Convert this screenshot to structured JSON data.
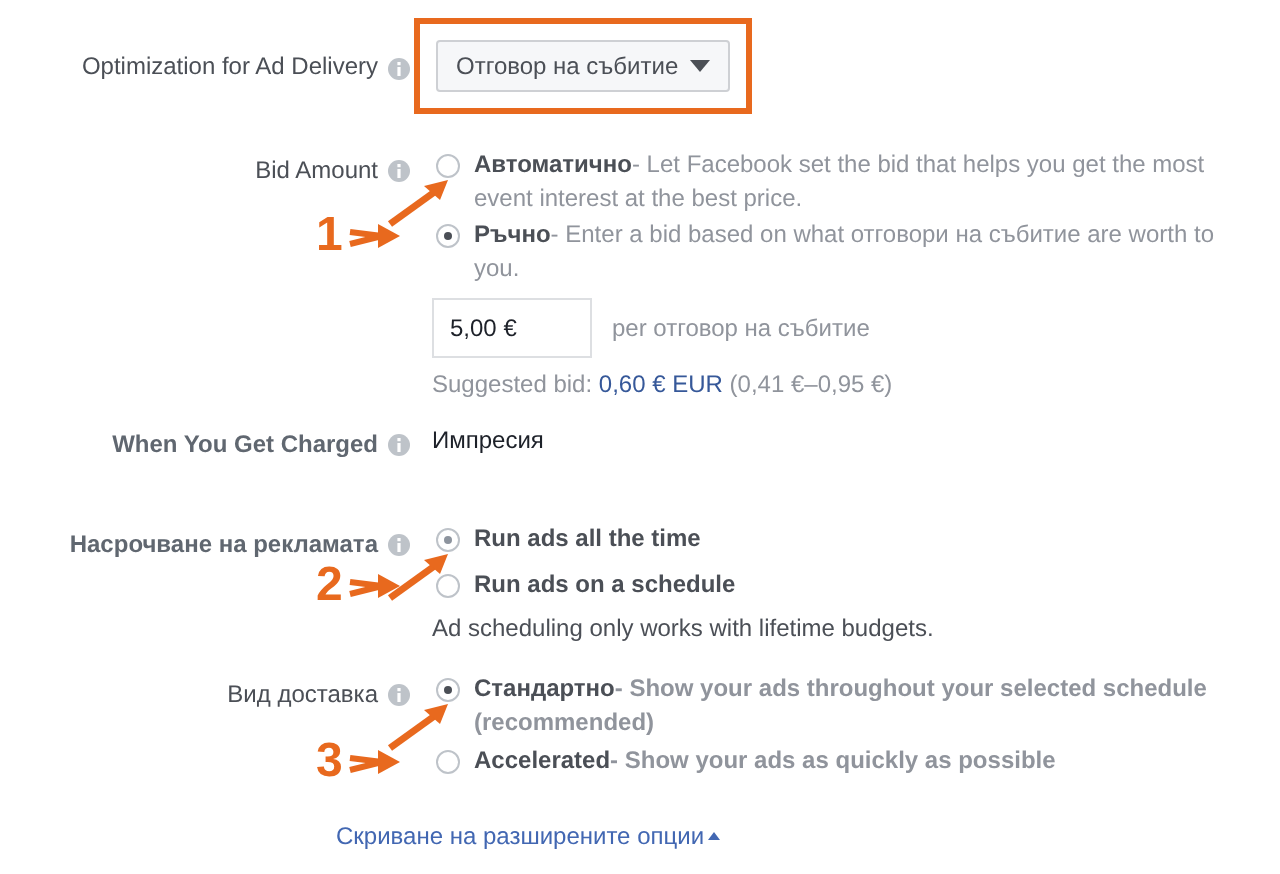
{
  "optimization": {
    "label": "Optimization for Ad Delivery",
    "value": "Отговор на събитие",
    "highlighted": true
  },
  "bid_amount": {
    "label": "Bid Amount",
    "annotation": "1",
    "options": [
      {
        "title": "Автоматично",
        "description": "- Let Facebook set the bid that helps you get the most event interest at the best price.",
        "selected": false
      },
      {
        "title": "Ръчно",
        "description": "- Enter a bid based on what отговори на събитие are worth to you.",
        "selected": true
      }
    ],
    "input_value": "5,00 €",
    "unit": "per отговор на събитие",
    "suggested_label": "Suggested bid:",
    "suggested_value": "0,60 € EUR",
    "suggested_range": "(0,41 €–0,95 €)"
  },
  "charged": {
    "label": "When You Get Charged",
    "value": "Импресия"
  },
  "scheduling": {
    "label": "Насрочване на рекламата",
    "annotation": "2",
    "options": [
      {
        "title": "Run ads all the time",
        "selected": true
      },
      {
        "title": "Run ads on a schedule",
        "selected": false
      }
    ],
    "note": "Ad scheduling only works with lifetime budgets."
  },
  "delivery": {
    "label": "Вид доставка",
    "annotation": "3",
    "options": [
      {
        "title": "Стандартно",
        "description": "- Show your ads throughout your selected schedule (recommended)",
        "selected": true
      },
      {
        "title": "Accelerated",
        "description": "- Show your ads as quickly as possible",
        "selected": false
      }
    ]
  },
  "toggle_link": "Скриване на разширените опции"
}
